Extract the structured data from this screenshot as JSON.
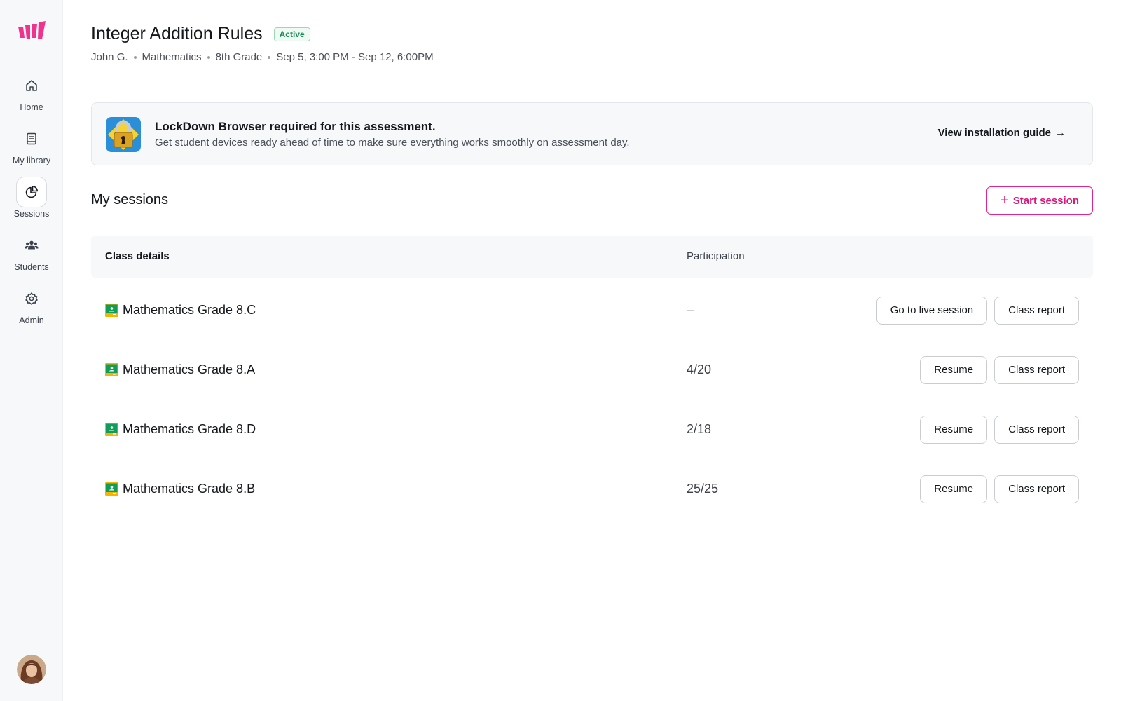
{
  "sidebar": {
    "logo": "brand-logo",
    "items": [
      {
        "label": "Home",
        "icon": "home-icon"
      },
      {
        "label": "My library",
        "icon": "book-icon"
      },
      {
        "label": "Sessions",
        "icon": "pie-chart-icon",
        "active": true
      },
      {
        "label": "Students",
        "icon": "users-icon"
      },
      {
        "label": "Admin",
        "icon": "gear-icon"
      }
    ]
  },
  "header": {
    "title": "Integer Addition Rules",
    "status": "Active",
    "meta": [
      "John G.",
      "Mathematics",
      "8th Grade",
      "Sep 5, 3:00 PM - Sep 12, 6:00PM"
    ]
  },
  "banner": {
    "title": "LockDown Browser required for this assessment.",
    "text": "Get student devices ready ahead of time to make sure everything works smoothly on assessment day.",
    "link": "View installation guide"
  },
  "sessions": {
    "title": "My sessions",
    "start_button": "Start session",
    "columns": [
      "Class details",
      "Participation"
    ],
    "rows": [
      {
        "class": "Mathematics Grade 8.C",
        "participation": "–",
        "primary_action": "Go to live session",
        "secondary_action": "Class report"
      },
      {
        "class": "Mathematics Grade 8.A",
        "participation": "4/20",
        "primary_action": "Resume",
        "secondary_action": "Class report"
      },
      {
        "class": "Mathematics Grade 8.D",
        "participation": "2/18",
        "primary_action": "Resume",
        "secondary_action": "Class report"
      },
      {
        "class": "Mathematics Grade 8.B",
        "participation": "25/25",
        "primary_action": "Resume",
        "secondary_action": "Class report"
      }
    ]
  },
  "colors": {
    "accent": "#e5248d",
    "active_badge": "#1b8a53"
  }
}
